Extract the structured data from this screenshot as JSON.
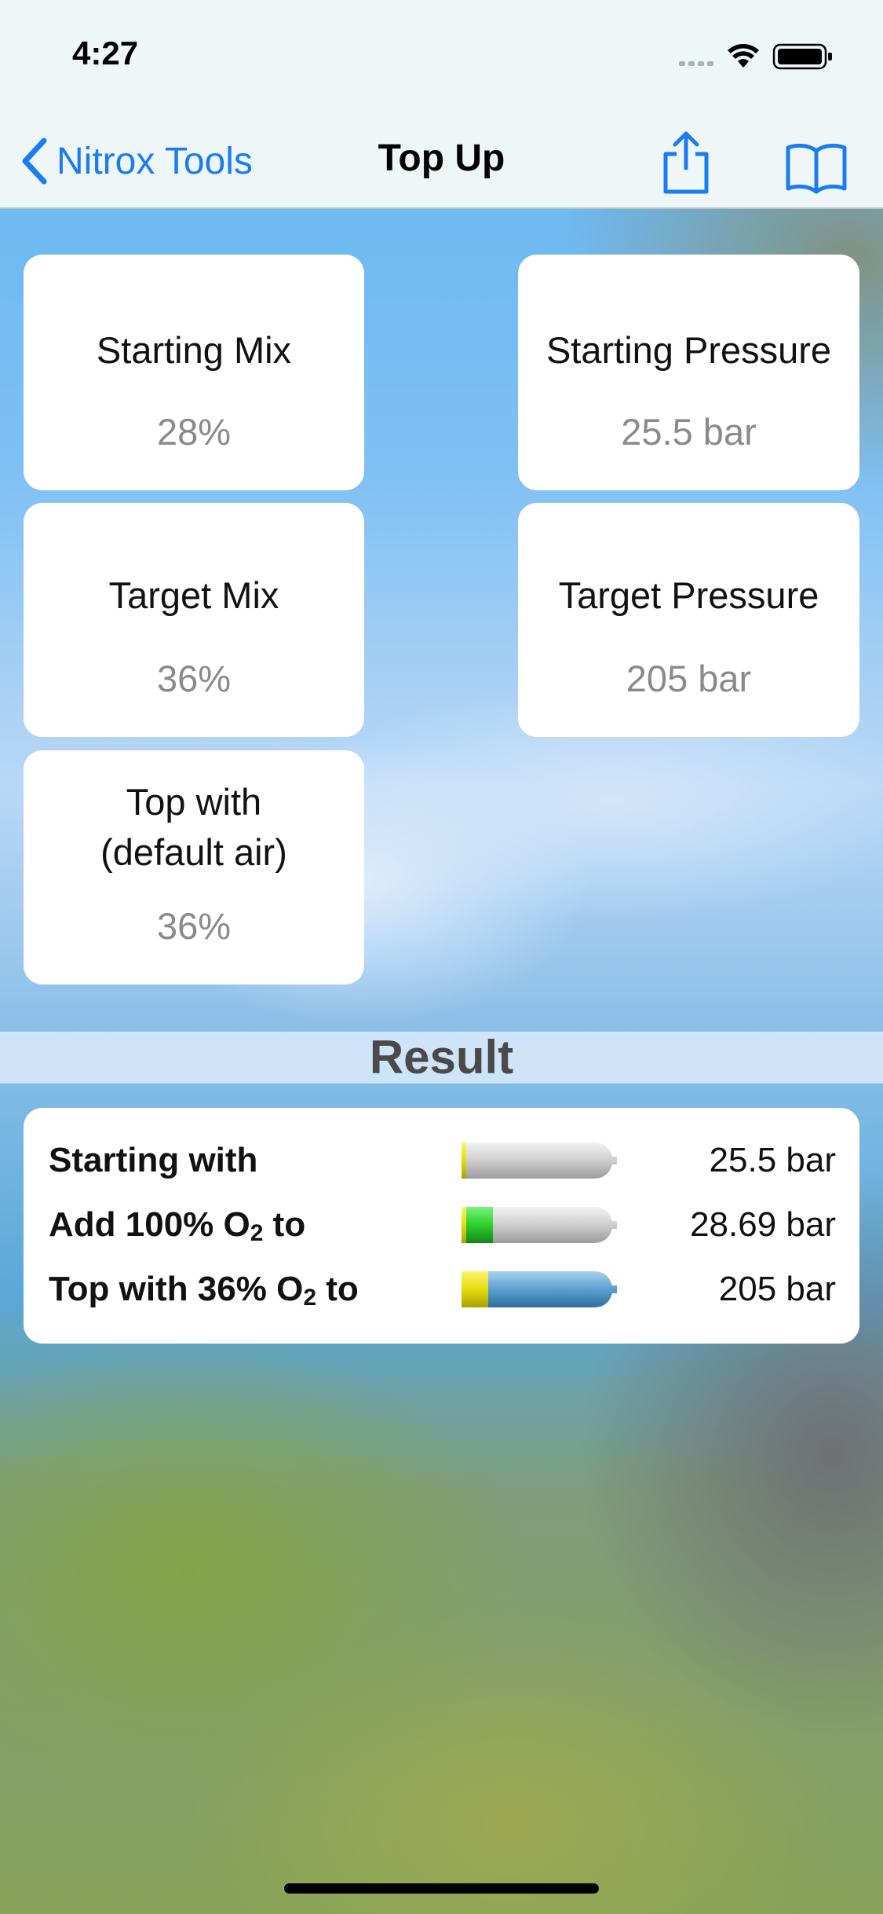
{
  "status_bar": {
    "time": "4:27"
  },
  "nav": {
    "back_label": "Nitrox Tools",
    "title": "Top Up",
    "share_icon": "share-icon",
    "book_icon": "book-icon"
  },
  "inputs": {
    "starting_mix": {
      "label": "Starting Mix",
      "value": "28%"
    },
    "starting_pressure": {
      "label": "Starting Pressure",
      "value": "25.5 bar"
    },
    "target_mix": {
      "label": "Target Mix",
      "value": "36%"
    },
    "target_pressure": {
      "label": "Target Pressure",
      "value": "205 bar"
    },
    "top_with": {
      "label_line1": "Top with",
      "label_line2": "(default air)",
      "value": "36%"
    }
  },
  "result": {
    "heading": "Result",
    "rows": [
      {
        "label": "Starting with",
        "value": "25.5 bar"
      },
      {
        "label_prefix": "Add 100% O",
        "label_sub": "2",
        "label_suffix": " to",
        "value": "28.69 bar"
      },
      {
        "label_prefix": "Top with 36% O",
        "label_sub": "2",
        "label_suffix": " to",
        "value": "205 bar"
      }
    ]
  },
  "colors": {
    "accent": "#1a7cf4",
    "oxygen_green": "#2dd12d",
    "nitrox_yellow": "#e6dc10",
    "fill_blue": "#5aa0d0",
    "tank_grey": "#c9c9c9"
  }
}
